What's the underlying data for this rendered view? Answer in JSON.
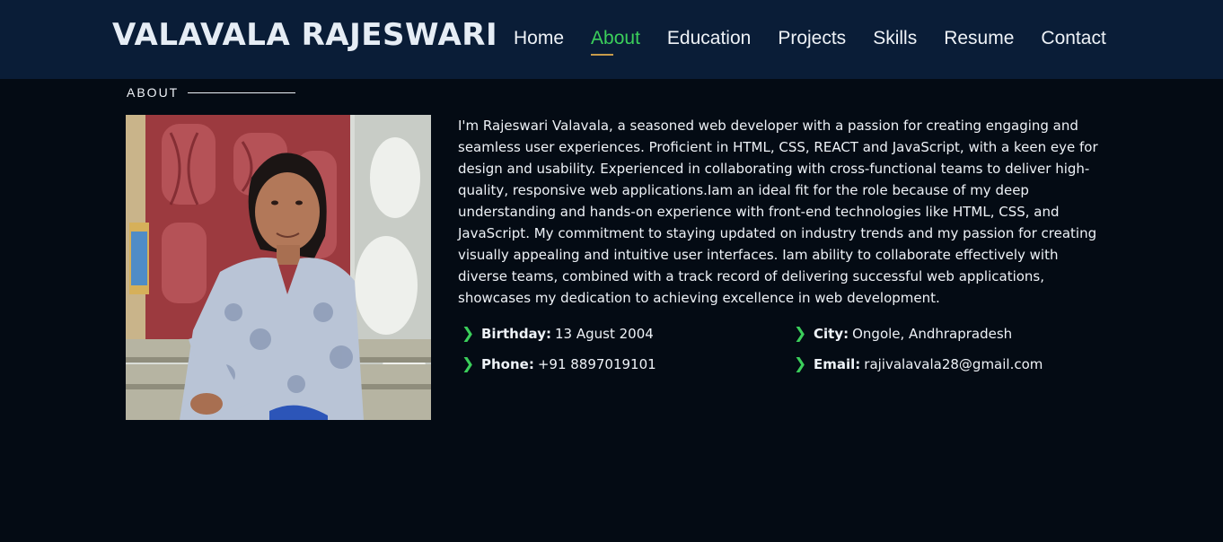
{
  "header": {
    "brand": "VALAVALA RAJESWARI",
    "nav": [
      {
        "label": "Home",
        "active": false
      },
      {
        "label": "About",
        "active": true
      },
      {
        "label": "Education",
        "active": false
      },
      {
        "label": "Projects",
        "active": false
      },
      {
        "label": "Skills",
        "active": false
      },
      {
        "label": "Resume",
        "active": false
      },
      {
        "label": "Contact",
        "active": false
      }
    ]
  },
  "about": {
    "section_title": "ABOUT",
    "bio": "I'm Rajeswari Valavala, a seasoned web developer with a passion for creating engaging and seamless user experiences. Proficient in HTML, CSS, REACT and JavaScript, with a keen eye for design and usability. Experienced in collaborating with cross-functional teams to deliver high-quality, responsive web applications.Iam an ideal fit for the role because of my deep understanding and hands-on experience with front-end technologies like HTML, CSS, and JavaScript. My commitment to staying updated on industry trends and my passion for creating visually appealing and intuitive user interfaces. Iam ability to collaborate effectively with diverse teams, combined with a track record of delivering successful web applications, showcases my dedication to achieving excellence in web development.",
    "details": {
      "birthday": {
        "label": "Birthday:",
        "value": "13 Agust 2004"
      },
      "city": {
        "label": "City:",
        "value": "Ongole, Andhrapradesh"
      },
      "phone": {
        "label": "Phone:",
        "value": "+91 8897019101"
      },
      "email": {
        "label": "Email:",
        "value": "rajivalavala28@gmail.com"
      }
    },
    "bullet_icon": "chevron-right-icon"
  },
  "colors": {
    "header_bg": "#0a1d37",
    "page_bg": "#040b14",
    "accent": "#3bcf5b",
    "active_underline": "#c89b4a"
  }
}
